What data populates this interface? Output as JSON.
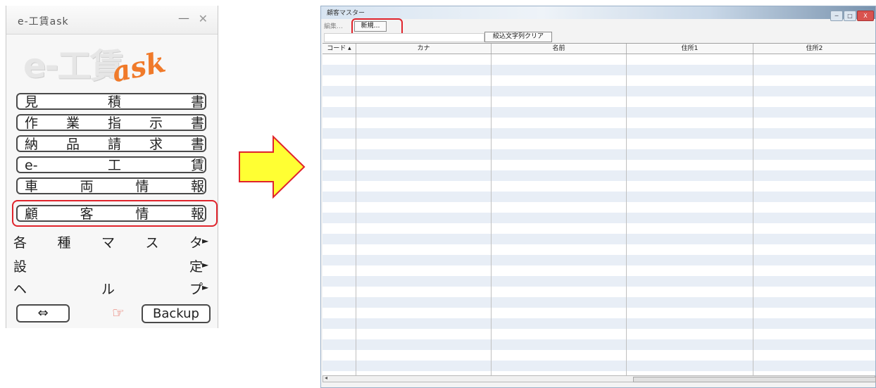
{
  "launcher": {
    "title": "e-工賃ask",
    "minimize": "—",
    "close": "✕",
    "logo_main": "e-工賃",
    "logo_ask": "ask",
    "buttons": [
      {
        "chars": [
          "見",
          "積",
          "書"
        ]
      },
      {
        "chars": [
          "作",
          "業",
          "指",
          "示",
          "書"
        ]
      },
      {
        "chars": [
          "納",
          "品",
          "請",
          "求",
          "書"
        ]
      },
      {
        "chars": [
          "e-",
          "工",
          "賃"
        ]
      },
      {
        "chars": [
          "車",
          "両",
          "情",
          "報"
        ]
      },
      {
        "chars": [
          "顧",
          "客",
          "情",
          "報"
        ]
      }
    ],
    "menus": [
      {
        "chars": [
          "各",
          "種",
          "マ",
          "ス",
          "タ"
        ],
        "arrow": "►"
      },
      {
        "chars": [
          "設",
          "定"
        ],
        "arrow": "►"
      },
      {
        "chars": [
          "ヘ",
          "ル",
          "プ"
        ],
        "arrow": "►"
      }
    ],
    "swap_label": "⇔",
    "hand_icon": "☞",
    "backup_label": "Backup"
  },
  "window": {
    "title": "顧客マスター",
    "toolbar": {
      "edit_label": "編集…",
      "new_label": "新規…",
      "clear_filter_label": "絞込文字列クリア"
    },
    "columns": [
      "コード ▴",
      "カナ",
      "名前",
      "住所1",
      "住所2"
    ],
    "row_count": 30,
    "scroll_left": "◂",
    "controls": {
      "min": "─",
      "max": "□",
      "close": "X"
    }
  },
  "colors": {
    "highlight": "#e0242c",
    "arrow_fill": "#ffff33",
    "arrow_stroke": "#e0242c",
    "row_stripe": "#e8eef6",
    "logo_ask": "#f07a2a"
  }
}
